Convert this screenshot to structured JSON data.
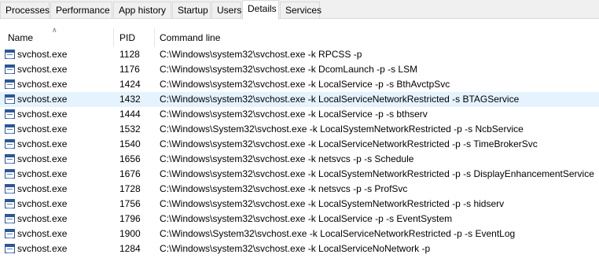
{
  "tabs": [
    {
      "label": "Processes"
    },
    {
      "label": "Performance"
    },
    {
      "label": "App history"
    },
    {
      "label": "Startup"
    },
    {
      "label": "Users"
    },
    {
      "label": "Details"
    },
    {
      "label": "Services"
    }
  ],
  "active_tab": "Details",
  "columns": {
    "name": "Name",
    "pid": "PID",
    "command_line": "Command line"
  },
  "sort": {
    "column": "Name",
    "direction": "ascending"
  },
  "selected_row_pid": "1432",
  "rows": [
    {
      "name": "svchost.exe",
      "pid": "1128",
      "cmd": "C:\\Windows\\system32\\svchost.exe -k RPCSS -p"
    },
    {
      "name": "svchost.exe",
      "pid": "1176",
      "cmd": "C:\\Windows\\system32\\svchost.exe -k DcomLaunch -p -s LSM"
    },
    {
      "name": "svchost.exe",
      "pid": "1424",
      "cmd": "C:\\Windows\\system32\\svchost.exe -k LocalService -p -s BthAvctpSvc"
    },
    {
      "name": "svchost.exe",
      "pid": "1432",
      "cmd": "C:\\Windows\\system32\\svchost.exe -k LocalServiceNetworkRestricted -s BTAGService"
    },
    {
      "name": "svchost.exe",
      "pid": "1444",
      "cmd": "C:\\Windows\\system32\\svchost.exe -k LocalService -p -s bthserv"
    },
    {
      "name": "svchost.exe",
      "pid": "1532",
      "cmd": "C:\\Windows\\System32\\svchost.exe -k LocalSystemNetworkRestricted -p -s NcbService"
    },
    {
      "name": "svchost.exe",
      "pid": "1540",
      "cmd": "C:\\Windows\\system32\\svchost.exe -k LocalServiceNetworkRestricted -p -s TimeBrokerSvc"
    },
    {
      "name": "svchost.exe",
      "pid": "1656",
      "cmd": "C:\\Windows\\system32\\svchost.exe -k netsvcs -p -s Schedule"
    },
    {
      "name": "svchost.exe",
      "pid": "1676",
      "cmd": "C:\\Windows\\system32\\svchost.exe -k LocalSystemNetworkRestricted -p -s DisplayEnhancementService"
    },
    {
      "name": "svchost.exe",
      "pid": "1728",
      "cmd": "C:\\Windows\\system32\\svchost.exe -k netsvcs -p -s ProfSvc"
    },
    {
      "name": "svchost.exe",
      "pid": "1756",
      "cmd": "C:\\Windows\\system32\\svchost.exe -k LocalSystemNetworkRestricted -p -s hidserv"
    },
    {
      "name": "svchost.exe",
      "pid": "1796",
      "cmd": "C:\\Windows\\system32\\svchost.exe -k LocalService -p -s EventSystem"
    },
    {
      "name": "svchost.exe",
      "pid": "1900",
      "cmd": "C:\\Windows\\System32\\svchost.exe -k LocalServiceNetworkRestricted -p -s EventLog"
    },
    {
      "name": "svchost.exe",
      "pid": "1284",
      "cmd": "C:\\Windows\\system32\\svchost.exe -k LocalServiceNoNetwork -p"
    }
  ]
}
